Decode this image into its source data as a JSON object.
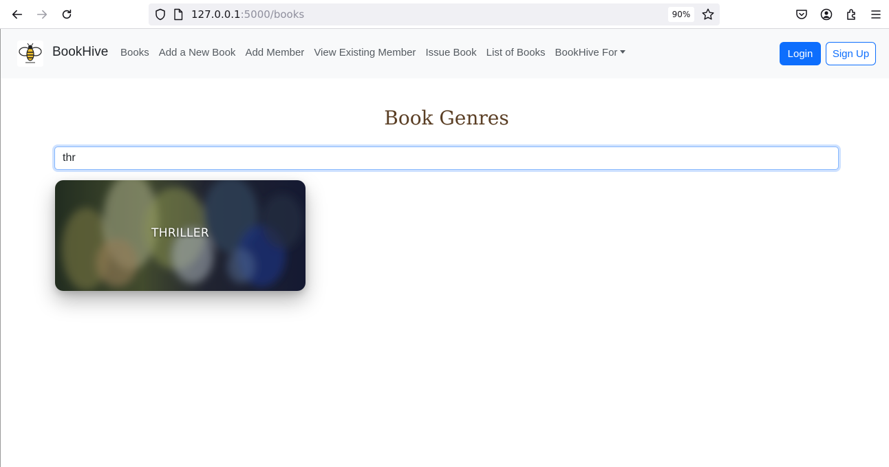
{
  "browser": {
    "url_host": "127.0.0.1",
    "url_rest": ":5000/books",
    "zoom": "90%"
  },
  "navbar": {
    "brand": "BookHive",
    "links": [
      "Books",
      "Add a New Book",
      "Add Member",
      "View Existing Member",
      "Issue Book",
      "List of Books",
      "BookHive For"
    ],
    "login_label": "Login",
    "signup_label": "Sign Up"
  },
  "main": {
    "title": "Book Genres",
    "search_value": "thr",
    "cards": [
      {
        "label": "THRILLER"
      }
    ]
  },
  "colors": {
    "primary": "#0d6efd",
    "title_brown": "#5a3e24",
    "navbar_bg": "#f8f9fa"
  }
}
